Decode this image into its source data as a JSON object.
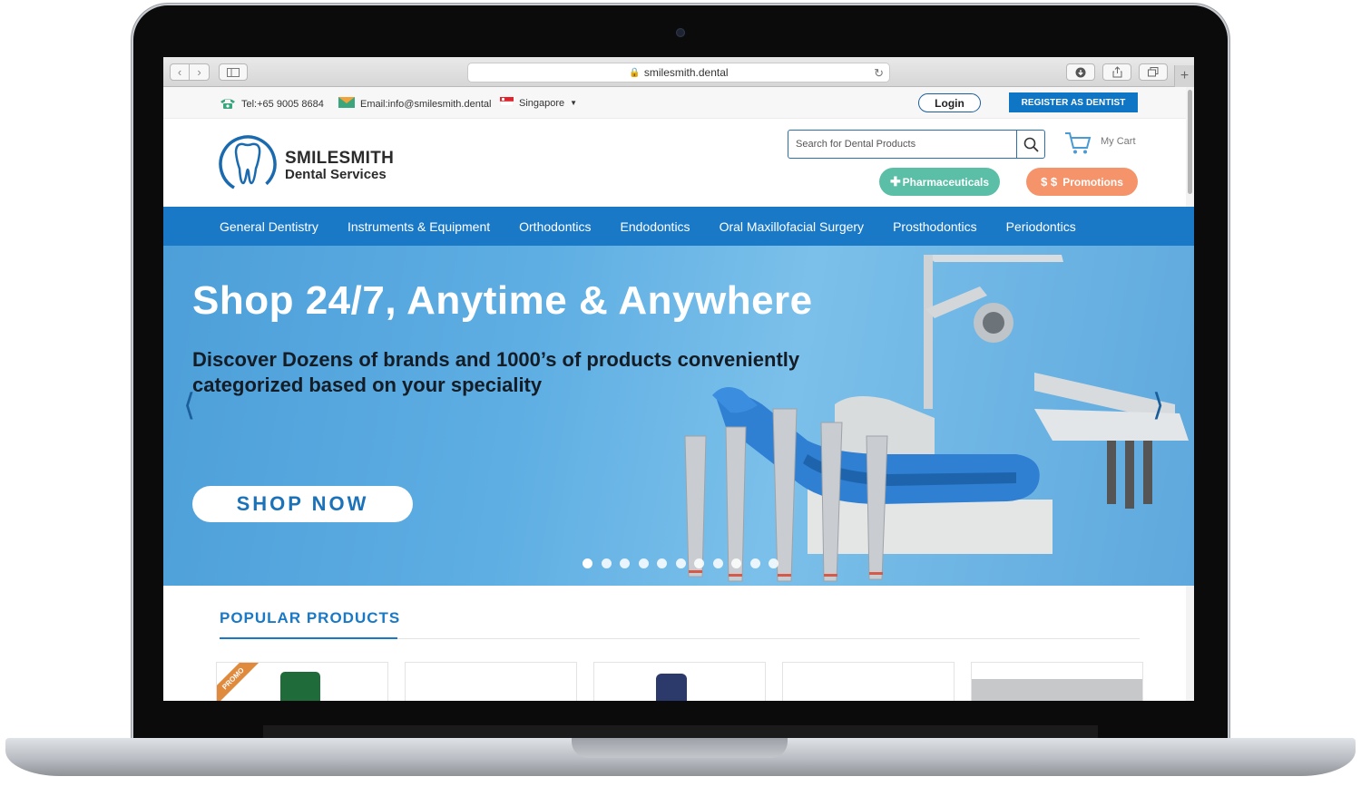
{
  "browser": {
    "url": "smilesmith.dental"
  },
  "topbar": {
    "tel": "Tel:+65 9005 8684",
    "email": "Email:info@smilesmith.dental",
    "country": "Singapore",
    "login": "Login",
    "register": "REGISTER AS DENTIST"
  },
  "header": {
    "logo_line1": "SMILESMITH",
    "logo_line2": "Dental Services",
    "search_placeholder": "Search for Dental Products",
    "cart": "My Cart",
    "pharma": "Pharmaceuticals",
    "promotions": "Promotions"
  },
  "nav": {
    "items": [
      "General Dentistry",
      "Instruments & Equipment",
      "Orthodontics",
      "Endodontics",
      "Oral Maxillofacial Surgery",
      "Prosthodontics",
      "Periodontics"
    ]
  },
  "hero": {
    "title": "Shop 24/7, Anytime & Anywhere",
    "subtitle": "Discover Dozens of brands and 1000’s of products conveniently categorized based on your speciality",
    "cta": "SHOP NOW",
    "slides": 11,
    "active_slide": 0
  },
  "popular": {
    "title": "POPULAR PRODUCTS",
    "promo_badge": "PROMO"
  },
  "colors": {
    "brand_blue": "#1a79c6",
    "pharma_green": "#5bbfa8",
    "promo_orange": "#f5946a"
  }
}
